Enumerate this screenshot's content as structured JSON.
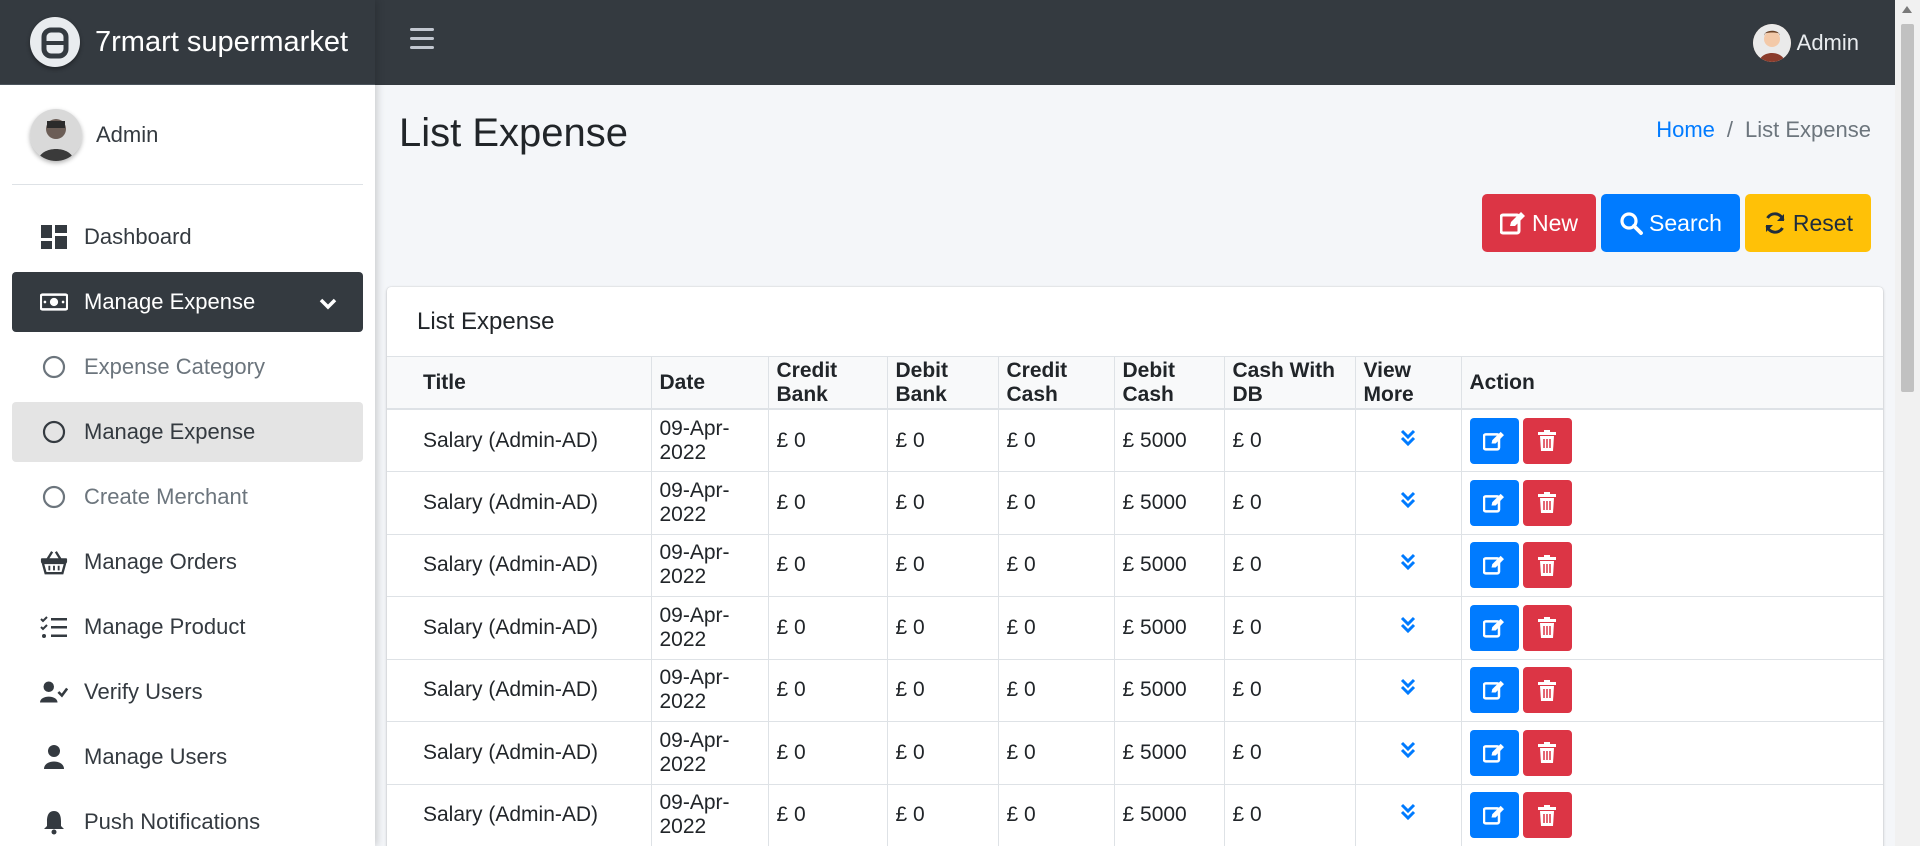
{
  "brand": {
    "name": "7rmart supermarket"
  },
  "sidebar": {
    "user": "Admin",
    "items": [
      {
        "label": "Dashboard",
        "icon": "dashboard-icon"
      },
      {
        "label": "Manage Expense",
        "icon": "money-bill-icon",
        "active": true
      },
      {
        "label": "Expense Category",
        "icon": "circle-icon",
        "sub": true
      },
      {
        "label": "Manage Expense",
        "icon": "circle-icon",
        "sub": true,
        "current": true
      },
      {
        "label": "Create Merchant",
        "icon": "circle-icon",
        "sub": true
      },
      {
        "label": "Manage Orders",
        "icon": "basket-icon"
      },
      {
        "label": "Manage Product",
        "icon": "tasks-icon"
      },
      {
        "label": "Verify Users",
        "icon": "user-check-icon"
      },
      {
        "label": "Manage Users",
        "icon": "user-icon"
      },
      {
        "label": "Push Notifications",
        "icon": "bell-icon"
      }
    ]
  },
  "topbar": {
    "user": "Admin"
  },
  "page": {
    "title": "List Expense",
    "breadcrumb": {
      "home": "Home",
      "separator": "/",
      "current": "List Expense"
    }
  },
  "buttons": {
    "new": "New",
    "search": "Search",
    "reset": "Reset"
  },
  "card": {
    "title": "List Expense"
  },
  "table": {
    "headers": [
      "Title",
      "Date",
      "Credit Bank",
      "Debit Bank",
      "Credit Cash",
      "Debit Cash",
      "Cash With DB",
      "View More",
      "Action"
    ],
    "rows": [
      [
        "Salary (Admin-AD)",
        "09-Apr-2022",
        "£ 0",
        "£ 0",
        "£ 0",
        "£ 5000",
        "£ 0"
      ],
      [
        "Salary (Admin-AD)",
        "09-Apr-2022",
        "£ 0",
        "£ 0",
        "£ 0",
        "£ 5000",
        "£ 0"
      ],
      [
        "Salary (Admin-AD)",
        "09-Apr-2022",
        "£ 0",
        "£ 0",
        "£ 0",
        "£ 5000",
        "£ 0"
      ],
      [
        "Salary (Admin-AD)",
        "09-Apr-2022",
        "£ 0",
        "£ 0",
        "£ 0",
        "£ 5000",
        "£ 0"
      ],
      [
        "Salary (Admin-AD)",
        "09-Apr-2022",
        "£ 0",
        "£ 0",
        "£ 0",
        "£ 5000",
        "£ 0"
      ],
      [
        "Salary (Admin-AD)",
        "09-Apr-2022",
        "£ 0",
        "£ 0",
        "£ 0",
        "£ 5000",
        "£ 0"
      ],
      [
        "Salary (Admin-AD)",
        "09-Apr-2022",
        "£ 0",
        "£ 0",
        "£ 0",
        "£ 5000",
        "£ 0"
      ]
    ]
  },
  "colors": {
    "topbar": "#343a40",
    "primary": "#007bff",
    "danger": "#dc3545",
    "warning": "#ffc107"
  }
}
